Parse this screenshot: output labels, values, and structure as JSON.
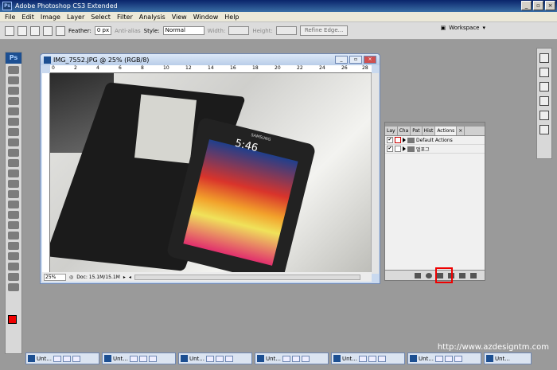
{
  "app": {
    "title": "Adobe Photoshop CS3 Extended"
  },
  "menu": [
    "File",
    "Edit",
    "Image",
    "Layer",
    "Select",
    "Filter",
    "Analysis",
    "View",
    "Window",
    "Help"
  ],
  "options": {
    "feather_label": "Feather:",
    "feather_value": "0 px",
    "antialias_label": "Anti-alias",
    "style_label": "Style:",
    "style_value": "Normal",
    "width_label": "Width:",
    "height_label": "Height:",
    "refine_label": "Refine Edge...",
    "workspace_label": "Workspace"
  },
  "document": {
    "title": "IMG_7552.JPG @ 25% (RGB/8)",
    "zoom": "25%",
    "doc_info": "Doc: 15.1M/15.1M",
    "ruler_labels": [
      "0",
      "2",
      "4",
      "6",
      "8",
      "10",
      "12",
      "14",
      "16",
      "18",
      "20",
      "22",
      "24",
      "26",
      "28"
    ],
    "phone_time": "5:46",
    "phone_brand": "SAMSUNG"
  },
  "panel": {
    "tabs": [
      "Lay",
      "Cha",
      "Pat",
      "Hist",
      "Actions"
    ],
    "active_tab": "Actions",
    "rows": [
      {
        "label": "Default Actions",
        "checked": true
      },
      {
        "label": "멀포그",
        "checked": true
      }
    ]
  },
  "taskbar": [
    "Unt...",
    "Unt...",
    "Unt...",
    "Unt...",
    "Unt...",
    "Unt...",
    "Unt..."
  ],
  "watermark": "http://www.azdesigntm.com",
  "colors": {
    "foreground": "#e00000",
    "background": "#ffffff",
    "highlight": "#e00000"
  }
}
